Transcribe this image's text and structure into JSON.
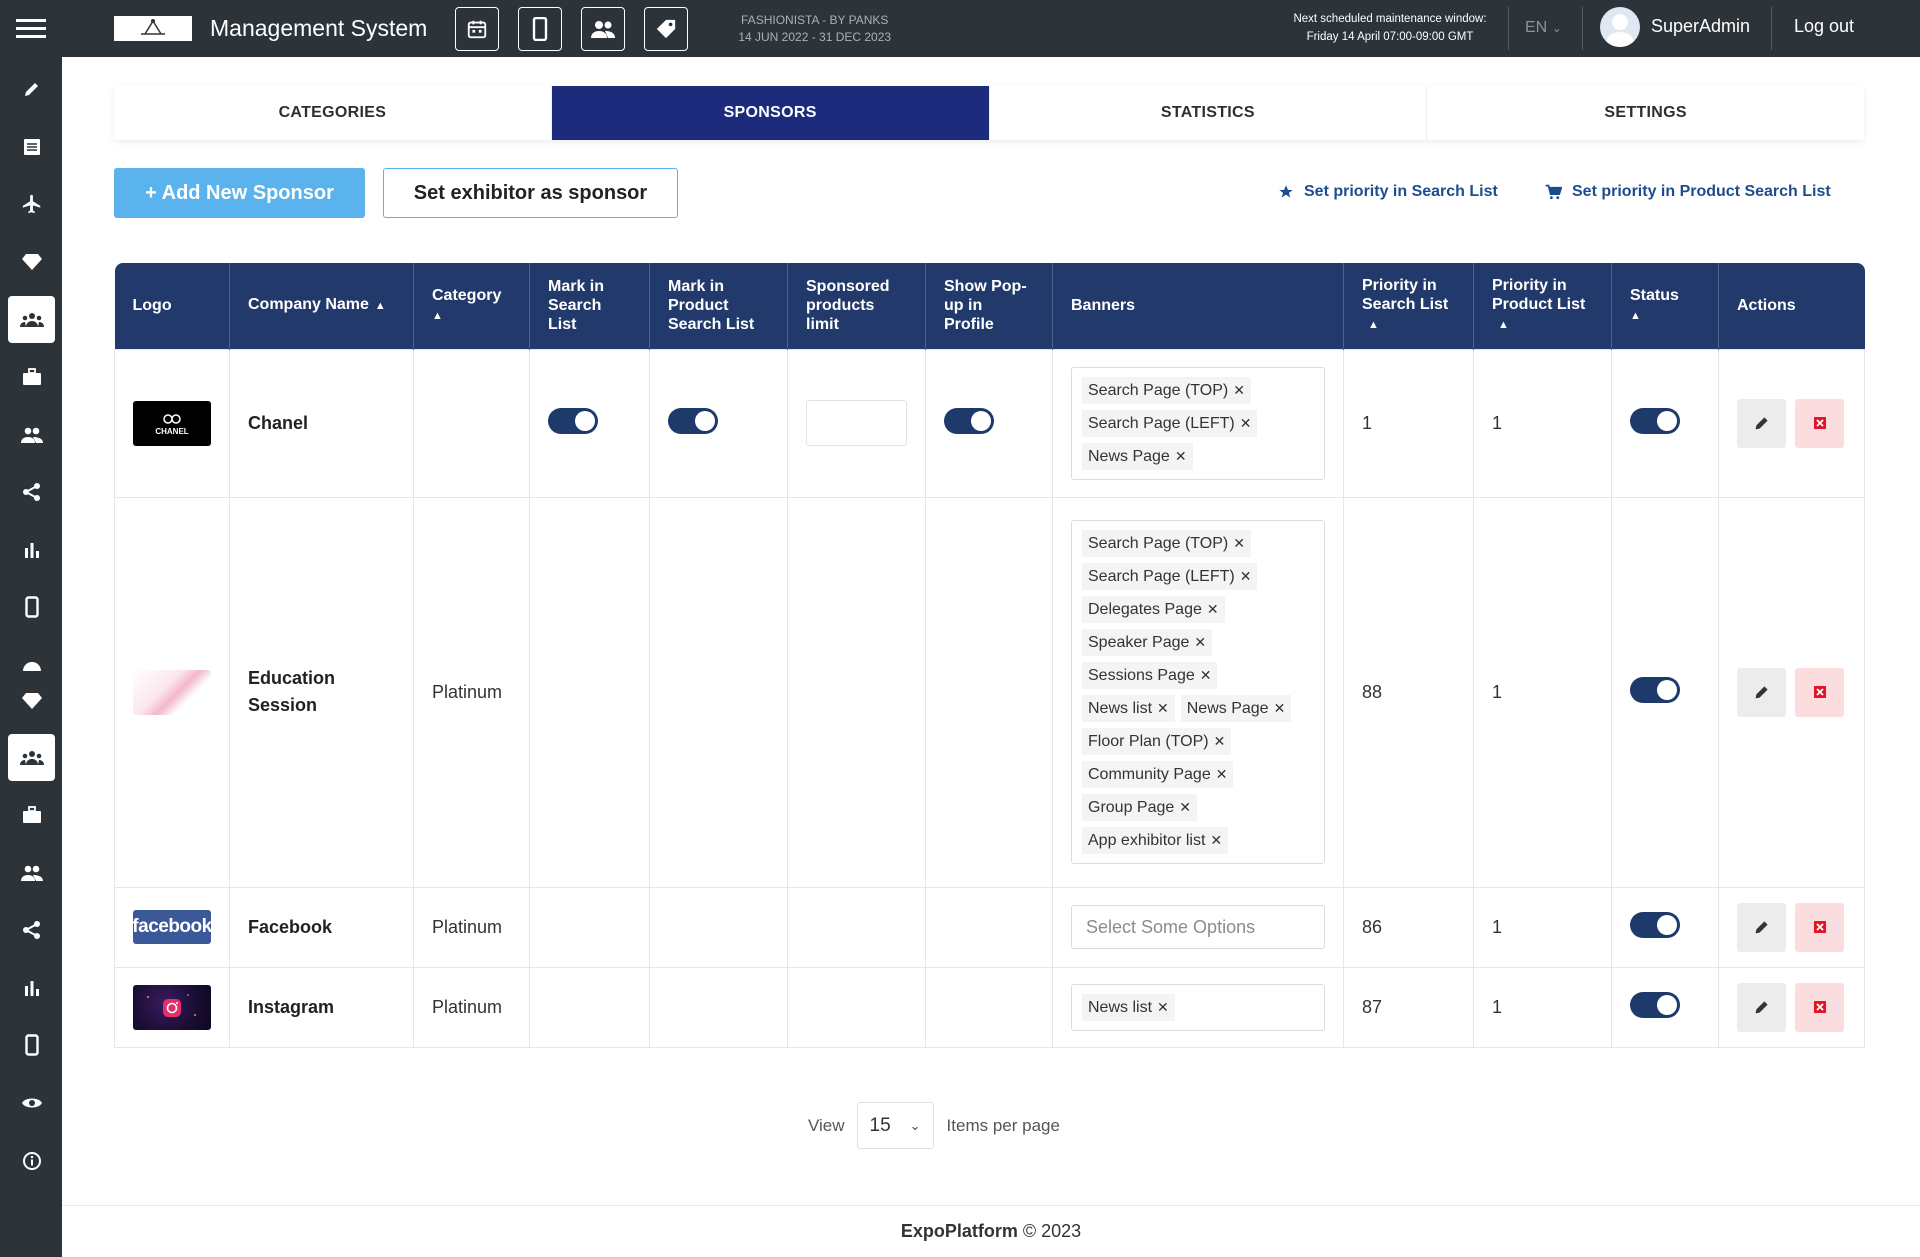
{
  "header": {
    "app_title": "Management System",
    "event_name": "FASHIONISTA - BY PANKS",
    "event_dates": "14 JUN 2022 - 31 DEC 2023",
    "maintenance_line1": "Next scheduled maintenance window:",
    "maintenance_line2": "Friday 14 April 07:00-09:00 GMT",
    "language": "EN",
    "username": "SuperAdmin",
    "logout": "Log out",
    "icons": [
      "calendar-icon",
      "mobile-icon",
      "users-icon",
      "tag-icon"
    ]
  },
  "sidebar": {
    "icons": [
      "pencil-icon",
      "list-icon",
      "plane-icon",
      "diamond-icon",
      "team-icon",
      "briefcase-icon",
      "people-icon",
      "share-icon",
      "bar-chart-icon",
      "mobile-icon",
      "dashboard-icon",
      "diamond-icon",
      "team-icon",
      "briefcase-icon",
      "people-icon",
      "share-icon",
      "bar-chart-icon",
      "mobile-icon",
      "eye-icon",
      "info-icon"
    ],
    "active": [
      "team-icon"
    ]
  },
  "tabs": [
    {
      "label": "CATEGORIES"
    },
    {
      "label": "SPONSORS",
      "active": true
    },
    {
      "label": "STATISTICS"
    },
    {
      "label": "SETTINGS"
    }
  ],
  "toolbar": {
    "add_label": "+ Add New Sponsor",
    "set_label": "Set exhibitor as sponsor",
    "priority_search": "Set priority in Search List",
    "priority_product": "Set priority in Product Search List"
  },
  "table": {
    "headers": {
      "logo": "Logo",
      "company": "Company Name",
      "category": "Category",
      "mark_search": "Mark in Search List",
      "mark_product": "Mark in Product Search List",
      "limit": "Sponsored products limit",
      "popup": "Show Pop-up in Profile",
      "banners": "Banners",
      "prio_search": "Priority in Search List",
      "prio_product": "Priority in Product List",
      "status": "Status",
      "actions": "Actions"
    },
    "rows": [
      {
        "company": "Chanel",
        "category": "",
        "banners": [
          "Search Page (TOP)",
          "Search Page (LEFT)",
          "News Page"
        ],
        "prio_search": "1",
        "prio_product": "1"
      },
      {
        "company": "Education Session",
        "category": "Platinum",
        "banners": [
          "Search Page (TOP)",
          "Search Page (LEFT)",
          "Delegates Page",
          "Speaker Page",
          "Sessions Page",
          "News list",
          "News Page",
          "Floor Plan (TOP)",
          "Community Page",
          "Group Page",
          "App exhibitor list"
        ],
        "prio_search": "88",
        "prio_product": "1"
      },
      {
        "company": "Facebook",
        "category": "Platinum",
        "banners": [],
        "banner_placeholder": "Select Some Options",
        "prio_search": "86",
        "prio_product": "1"
      },
      {
        "company": "Instagram",
        "category": "Platinum",
        "banners": [
          "News list"
        ],
        "prio_search": "87",
        "prio_product": "1"
      }
    ],
    "logo_text": {
      "chanel": "CHANEL",
      "facebook": "facebook"
    }
  },
  "pagination": {
    "view_label": "View",
    "per_page": "15",
    "items_label": "Items per page"
  },
  "footer": {
    "brand": "ExpoPlatform",
    "copyright": "© 2023"
  },
  "colors": {
    "topbar": "#2c3339",
    "tab_active": "#1d2b7c",
    "table_header": "#223a6b",
    "add_button": "#5ab3ec",
    "toggle": "#1d3a6b",
    "delete_bg": "#fbdcdf",
    "delete_icon": "#e0162b"
  }
}
